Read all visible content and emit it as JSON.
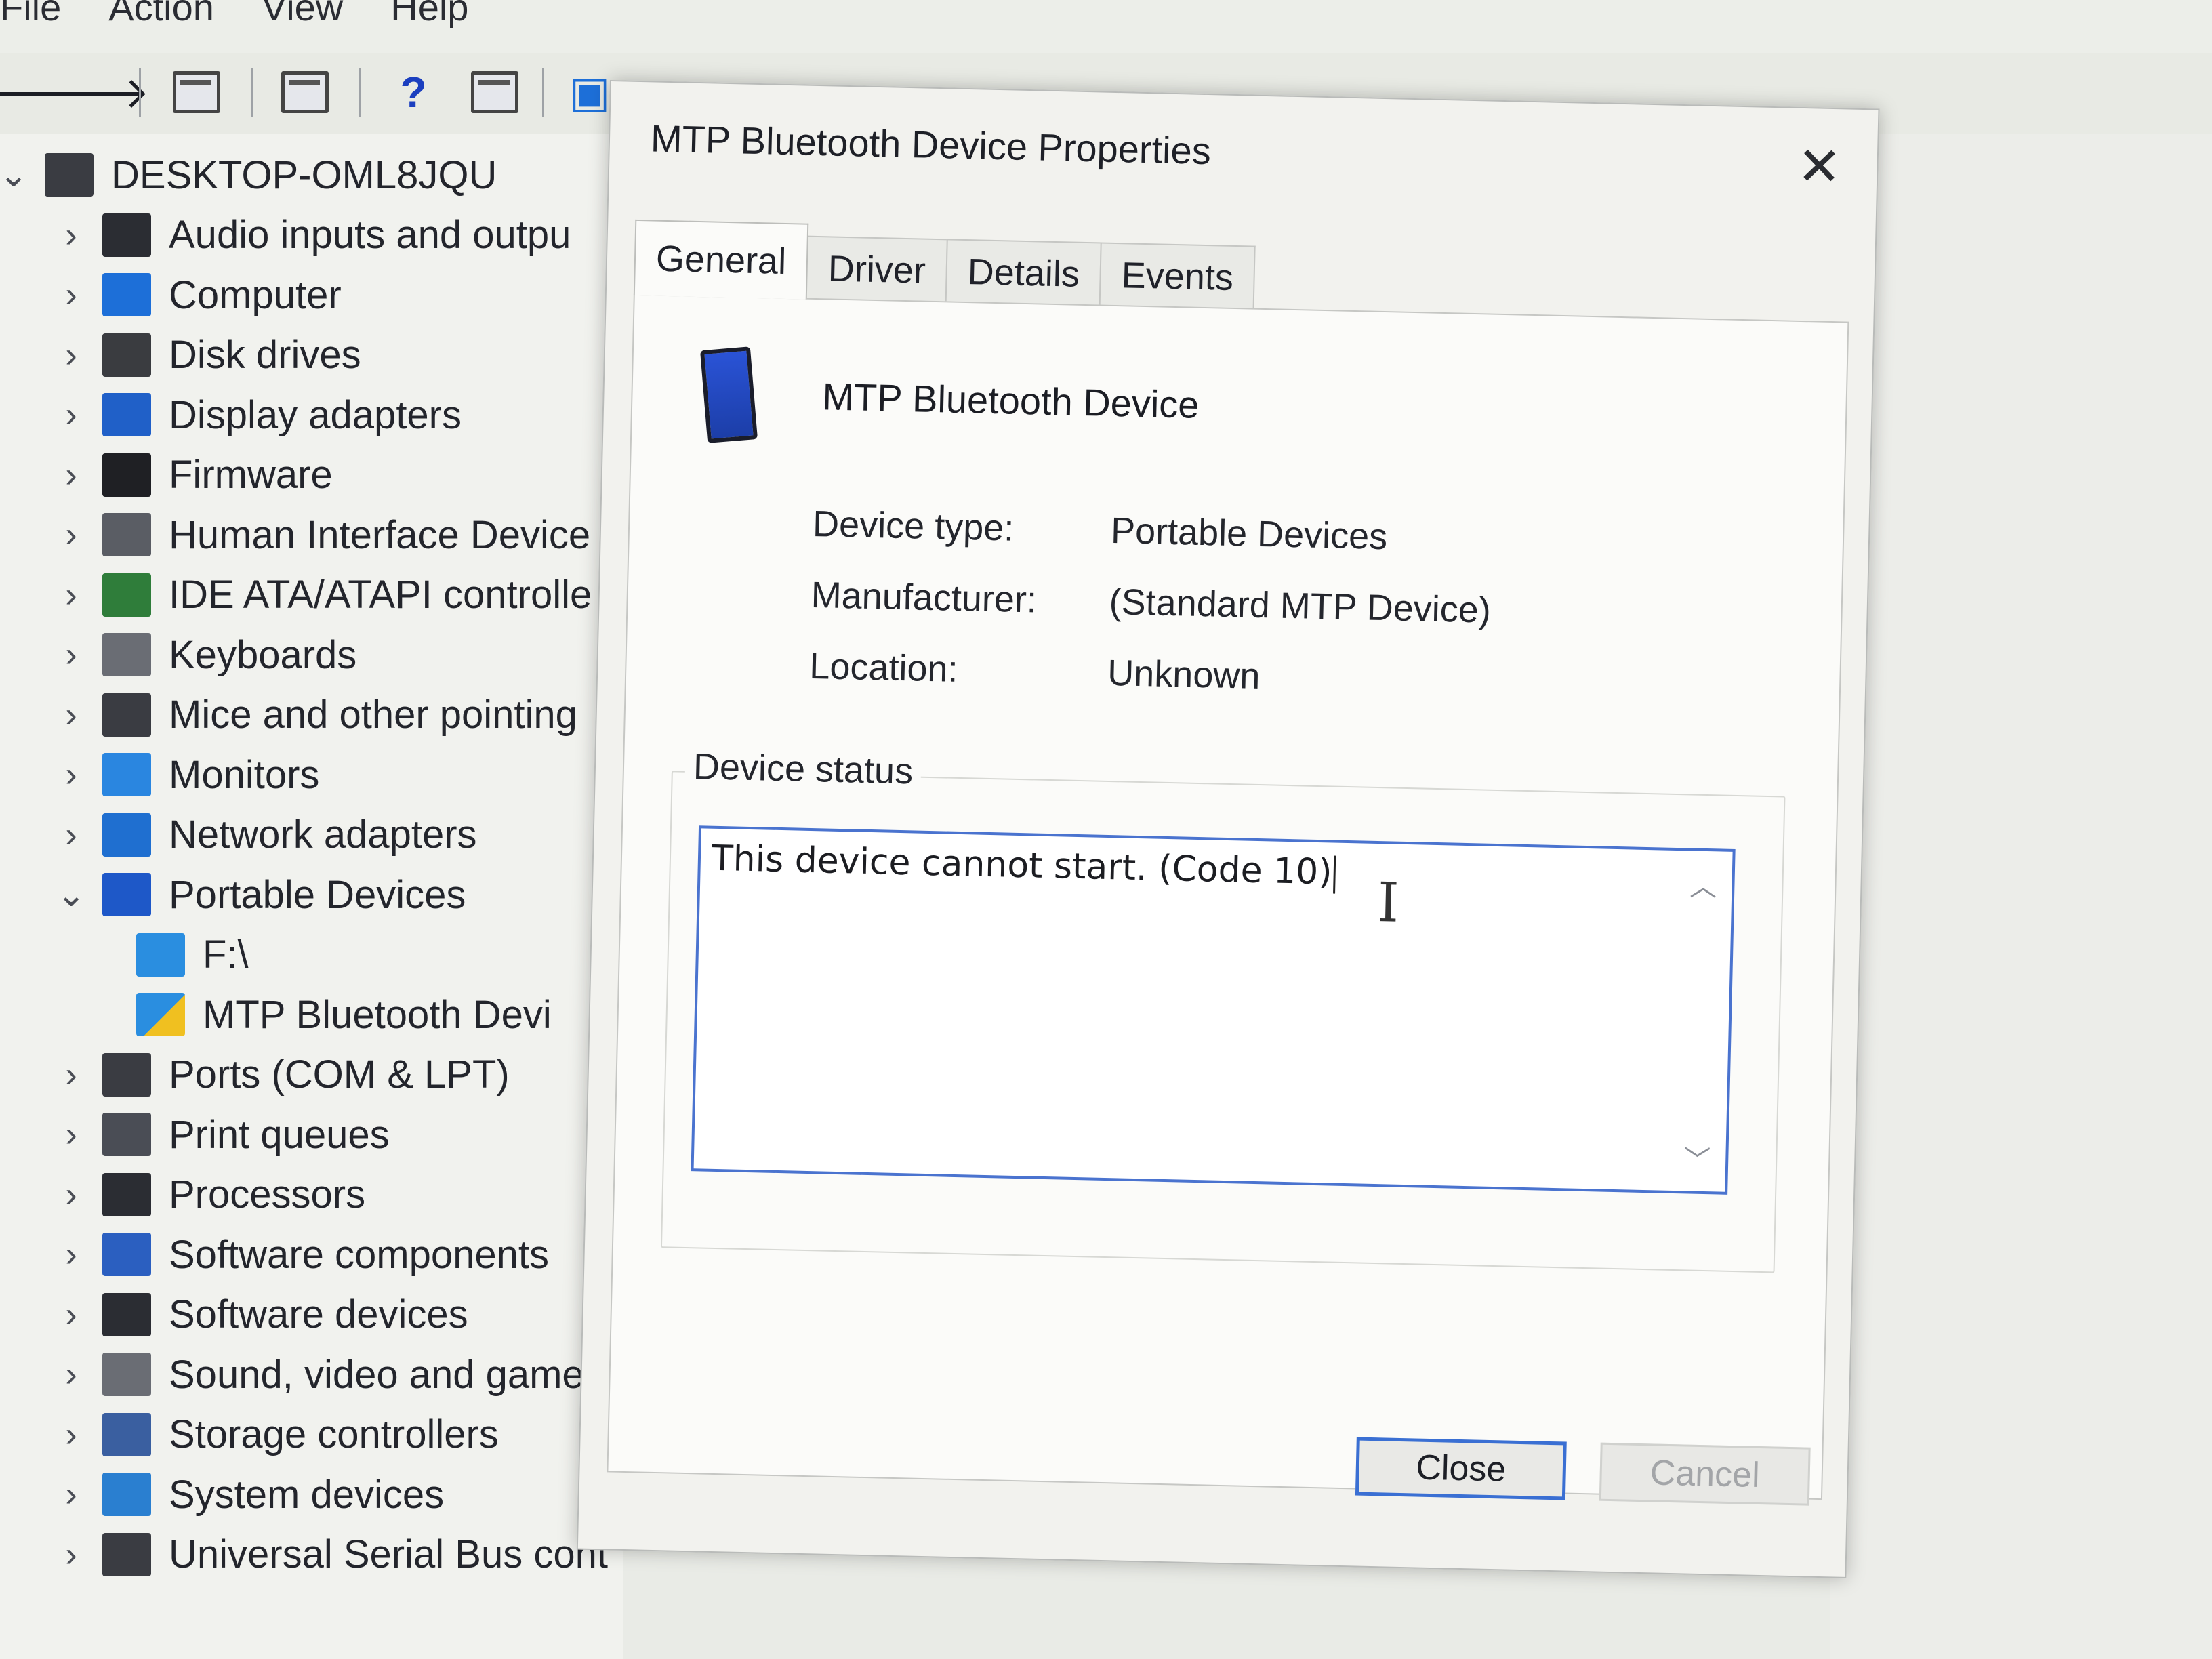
{
  "menu": [
    "File",
    "Action",
    "View",
    "Help"
  ],
  "tree": {
    "root": "DESKTOP-OML8JQU",
    "categories": [
      {
        "label": "Audio inputs and outpu",
        "icon": "speaker-icon",
        "color": "#2b2d33"
      },
      {
        "label": "Computer",
        "icon": "monitor-icon",
        "color": "#1d6fd8"
      },
      {
        "label": "Disk drives",
        "icon": "disk-drive-icon",
        "color": "#3a3c40"
      },
      {
        "label": "Display adapters",
        "icon": "display-adapter-icon",
        "color": "#2060c8"
      },
      {
        "label": "Firmware",
        "icon": "firmware-chip-icon",
        "color": "#1f2024"
      },
      {
        "label": "Human Interface Device",
        "icon": "keyboard-icon",
        "color": "#5a5d64"
      },
      {
        "label": "IDE ATA/ATAPI controlle",
        "icon": "ide-controller-icon",
        "color": "#2f7d3a"
      },
      {
        "label": "Keyboards",
        "icon": "keyboard-icon",
        "color": "#6a6d74"
      },
      {
        "label": "Mice and other pointing",
        "icon": "mouse-icon",
        "color": "#3a3c42"
      },
      {
        "label": "Monitors",
        "icon": "monitor-icon",
        "color": "#2a86e0"
      },
      {
        "label": "Network adapters",
        "icon": "network-icon",
        "color": "#1f6fd0"
      },
      {
        "label": "Portable Devices",
        "icon": "portable-device-icon",
        "color": "#1e58c8",
        "expanded": true
      }
    ],
    "children": [
      {
        "label": "F:\\",
        "icon": "portable-device-icon",
        "color": "#2a8ee0"
      },
      {
        "label": "MTP Bluetooth Devi",
        "icon": "warning-device-icon",
        "color": "#d8a020"
      }
    ],
    "categories_after": [
      {
        "label": "Ports (COM & LPT)",
        "icon": "port-icon",
        "color": "#3a3c42"
      },
      {
        "label": "Print queues",
        "icon": "printer-icon",
        "color": "#4a4d55"
      },
      {
        "label": "Processors",
        "icon": "processor-icon",
        "color": "#2b2d33"
      },
      {
        "label": "Software components",
        "icon": "software-component-icon",
        "color": "#2b5fc0"
      },
      {
        "label": "Software devices",
        "icon": "software-device-icon",
        "color": "#2b2d33"
      },
      {
        "label": "Sound, video and game",
        "icon": "speaker-icon",
        "color": "#6a6d74"
      },
      {
        "label": "Storage controllers",
        "icon": "storage-controller-icon",
        "color": "#3a5fa0"
      },
      {
        "label": "System devices",
        "icon": "folder-icon",
        "color": "#2a7fd0"
      },
      {
        "label": "Universal Serial Bus cont",
        "icon": "usb-icon",
        "color": "#3a3c42"
      }
    ]
  },
  "dialog": {
    "title": "MTP Bluetooth Device Properties",
    "close_glyph": "✕",
    "tabs": [
      "General",
      "Driver",
      "Details",
      "Events"
    ],
    "device_name": "MTP Bluetooth Device",
    "device_type_label": "Device type:",
    "device_type": "Portable Devices",
    "manufacturer_label": "Manufacturer:",
    "manufacturer": "(Standard MTP Device)",
    "location_label": "Location:",
    "location": "Unknown",
    "status_label": "Device status",
    "status_text": "This device cannot start. (Code 10)",
    "close_button": "Close",
    "cancel_button": "Cancel"
  },
  "colors": {
    "accent": "#3a6fd3",
    "focus_border": "#4a73cf"
  }
}
